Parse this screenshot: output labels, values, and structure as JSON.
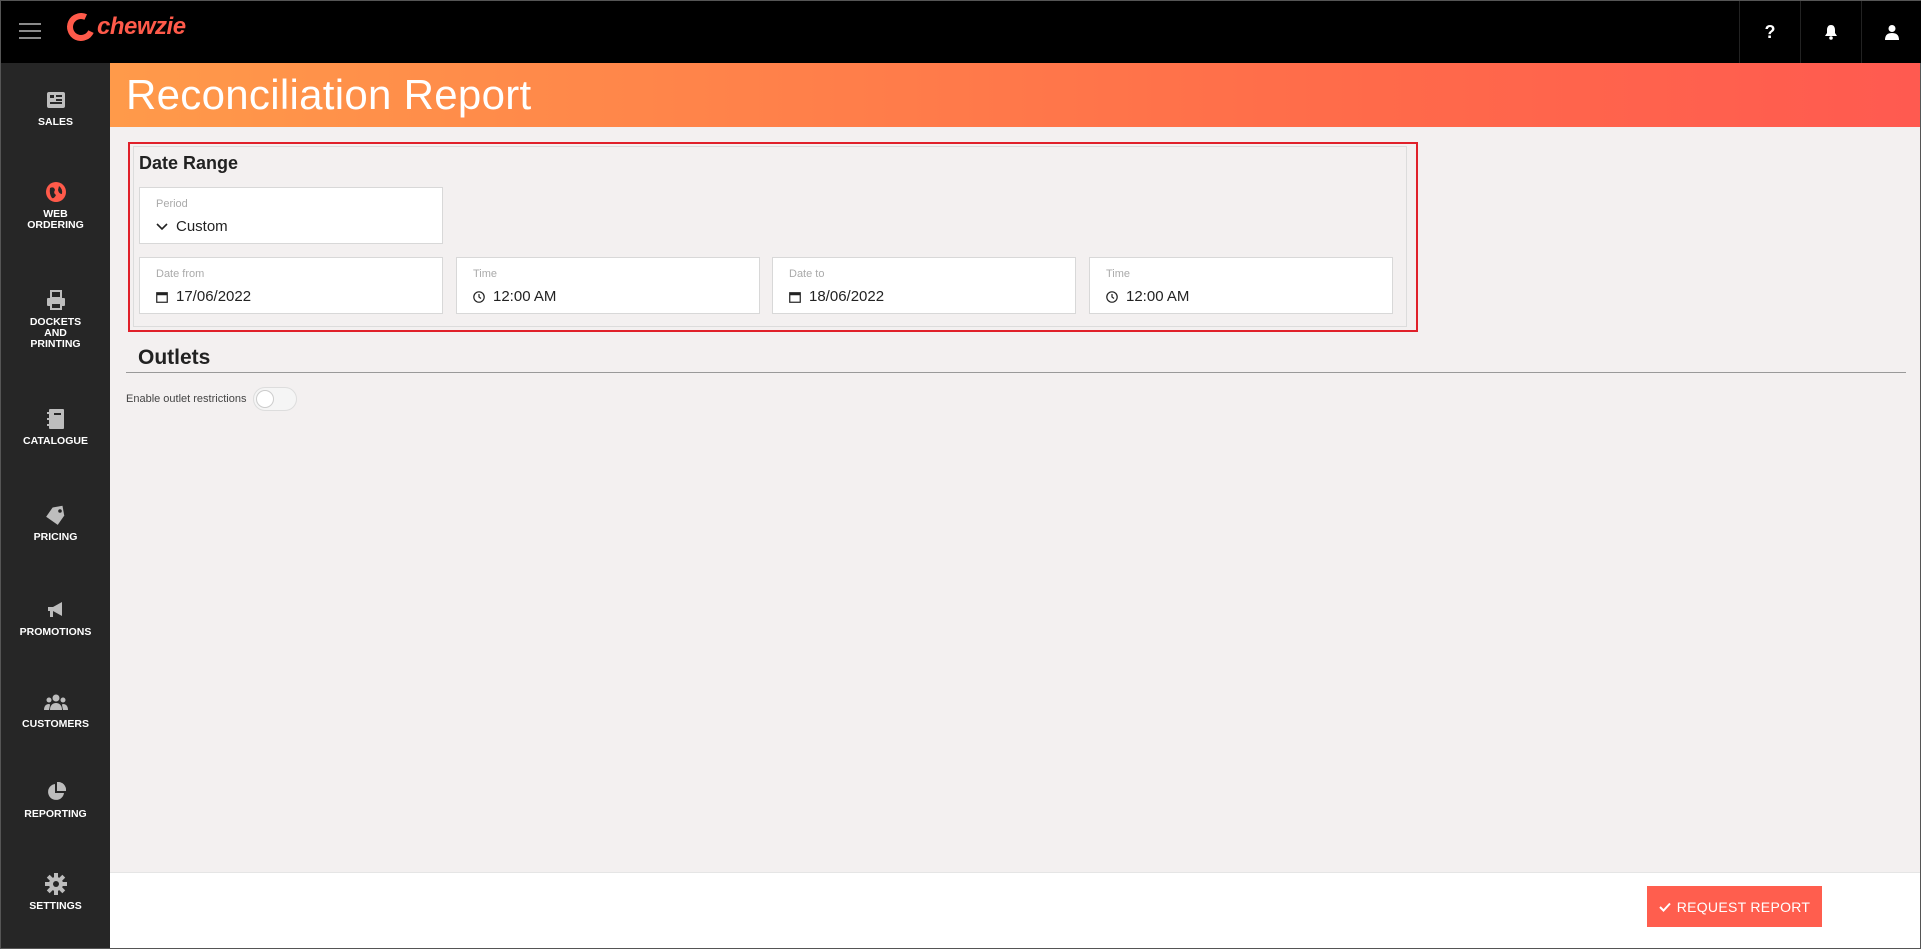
{
  "app": {
    "brand": "chewzie"
  },
  "topbar": {
    "help_label": "?",
    "icons": [
      "help-icon",
      "bell-icon",
      "user-icon"
    ]
  },
  "sidebar": {
    "items": [
      {
        "label": "SALES",
        "icon": "sales-icon"
      },
      {
        "label": "WEB\nORDERING",
        "icon": "globe-icon"
      },
      {
        "label": "DOCKETS\nAND\nPRINTING",
        "icon": "printer-icon"
      },
      {
        "label": "CATALOGUE",
        "icon": "book-icon"
      },
      {
        "label": "PRICING",
        "icon": "tag-icon"
      },
      {
        "label": "PROMOTIONS",
        "icon": "megaphone-icon"
      },
      {
        "label": "CUSTOMERS",
        "icon": "users-icon"
      },
      {
        "label": "REPORTING",
        "icon": "pie-chart-icon"
      },
      {
        "label": "SETTINGS",
        "icon": "gear-icon"
      }
    ]
  },
  "page": {
    "title": "Reconciliation Report"
  },
  "date_range": {
    "title": "Date Range",
    "period": {
      "label": "Period",
      "value": "Custom"
    },
    "date_from": {
      "label": "Date from",
      "value": "17/06/2022"
    },
    "time_from": {
      "label": "Time",
      "value": "12:00 AM"
    },
    "date_to": {
      "label": "Date to",
      "value": "18/06/2022"
    },
    "time_to": {
      "label": "Time",
      "value": "12:00 AM"
    }
  },
  "outlets": {
    "title": "Outlets",
    "toggle_label": "Enable outlet restrictions",
    "toggle_on": false
  },
  "footer": {
    "request_label": "REQUEST REPORT"
  },
  "colors": {
    "accent": "#ff5e4e",
    "banner_start": "#ff9a4a",
    "banner_end": "#ff5a50",
    "sidebar_bg": "#262626",
    "topbar_bg": "#000000",
    "highlight": "#e0202a"
  }
}
